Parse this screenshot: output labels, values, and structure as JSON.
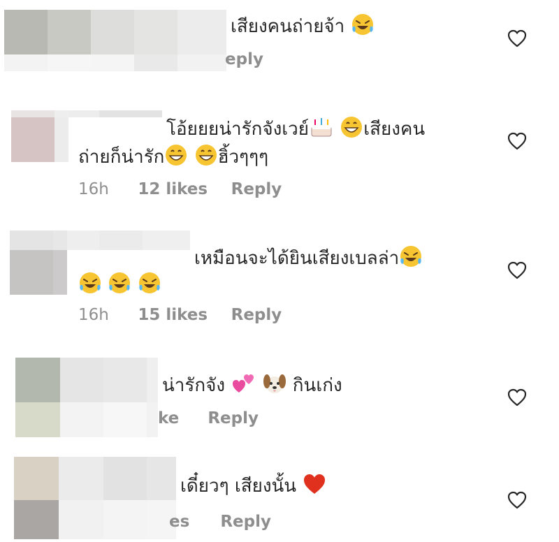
{
  "comments": [
    {
      "segments": [
        "เสียงคนถ่ายจ้า "
      ],
      "emojis_after": [
        "laughing-tears-icon"
      ],
      "meta_fragment": "eply",
      "like_icon": "heart-outline-icon"
    },
    {
      "line1": "โอ้ยยยน่ารักจังเวย์",
      "line1_tail": "เสียงคน",
      "line2": "ถ่ายก็น่ารัก",
      "line2_tail": "ฮิ้วๆๆๆ",
      "time": "16h",
      "likes": "12 likes",
      "reply": "Reply",
      "like_icon": "heart-outline-icon"
    },
    {
      "line1": "เหมือนจะได้ยินเสียงเบลล่า",
      "time": "16h",
      "likes": "15 likes",
      "reply": "Reply",
      "like_icon": "heart-outline-icon"
    },
    {
      "line1": "น่ารักจัง ",
      "line1_tail": " กินเก่ง",
      "meta_fragment": "ke",
      "reply": "Reply",
      "like_icon": "heart-outline-icon"
    },
    {
      "line1": "เดี๋ยวๆ เสียงนั้น ",
      "meta_fragment": "es",
      "reply": "Reply",
      "like_icon": "heart-outline-icon"
    }
  ],
  "colors": {
    "text": "#262626",
    "meta": "#8e8e8e",
    "heart_stroke": "#262626",
    "red_heart": "#e0311f",
    "emoji_yellow": "#f7c531"
  }
}
